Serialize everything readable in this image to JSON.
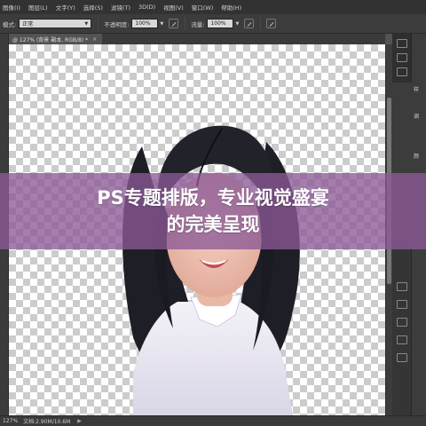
{
  "menu": {
    "items": [
      "图像(I)",
      "图层(L)",
      "文字(Y)",
      "选择(S)",
      "滤镜(T)",
      "3D(D)",
      "视图(V)",
      "窗口(W)",
      "帮助(H)"
    ]
  },
  "options": {
    "mode_label": "模式:",
    "mode_value": "正常",
    "opacity_label": "不透明度:",
    "opacity_value": "100%",
    "flow_label": "流量:",
    "flow_value": "100%"
  },
  "document": {
    "tab_title": "@ 127% (背景 副本, RGB/8) *",
    "close_glyph": "×"
  },
  "right_panel": {
    "labels": [
      "样",
      "调",
      "颜"
    ]
  },
  "statusbar": {
    "zoom": "127%",
    "doc_info": "文档:2.90M/10.6M",
    "arrow_glyph": "▶"
  },
  "banner": {
    "line1": "PS专题排版，专业视觉盛宴",
    "line2": "的完美呈现"
  },
  "colors": {
    "banner_overlay": "#8c5a96",
    "ui_dark": "#323232",
    "ui_panel": "#3c3c3c"
  },
  "icons": [
    "airbrush-icon",
    "pressure-icon",
    "menu-arrow-icon"
  ]
}
